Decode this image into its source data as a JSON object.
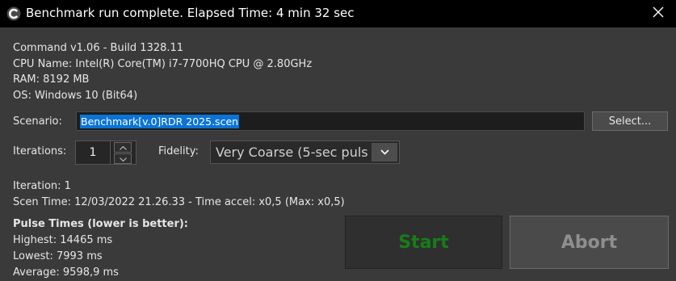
{
  "window": {
    "title": "Benchmark run complete. Elapsed Time: 4 min 32 sec",
    "icon": "app-logo-icon",
    "close_icon": "close-icon"
  },
  "system_info": {
    "command": "Command v1.06 - Build 1328.11",
    "cpu": "CPU Name: Intel(R) Core(TM) i7-7700HQ CPU @ 2.80GHz",
    "ram": "RAM: 8192 MB",
    "os": "OS: Windows 10 (Bit64)"
  },
  "scenario": {
    "label": "Scenario:",
    "value": "Benchmark[v.0]RDR 2025.scen",
    "select_label": "Select..."
  },
  "iterations": {
    "label": "Iterations:",
    "value": "1"
  },
  "fidelity": {
    "label": "Fidelity:",
    "value": "Very Coarse (5-sec puls"
  },
  "status": {
    "iteration": "Iteration: 1",
    "scen_time": "Scen Time: 12/03/2022 21.26.33 - Time accel: x0,5 (Max: x0,5)"
  },
  "pulse_times": {
    "heading": "Pulse Times (lower is better):",
    "highest": "Highest: 14465 ms",
    "lowest": "Lowest: 7993 ms",
    "average": "Average: 9598,9 ms"
  },
  "actions": {
    "start_label": "Start",
    "abort_label": "Abort",
    "start_color": "#167d16",
    "abort_color": "#8f8f8f"
  },
  "colors": {
    "titlebar_bg": "#000000",
    "window_bg": "#3a3a3a",
    "selection": "#0a74d6"
  }
}
